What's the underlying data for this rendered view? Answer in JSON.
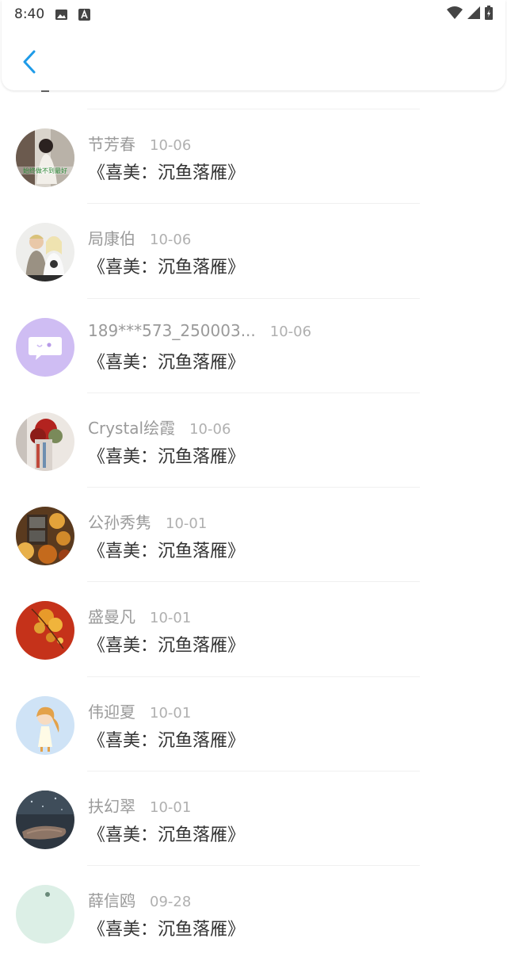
{
  "status_bar": {
    "time": "8:40"
  },
  "header": {
    "back_icon": "chevron-left-icon",
    "accent": "#1e9be8"
  },
  "items": [
    {
      "name": "节芳春",
      "date": "10-06",
      "content": "《喜美：沉鱼落雁》",
      "avatar_text": "始终做不到最好"
    },
    {
      "name": "局康伯",
      "date": "10-06",
      "content": "《喜美：沉鱼落雁》"
    },
    {
      "name": "189***573_250003...",
      "date": "10-06",
      "content": "《喜美：沉鱼落雁》"
    },
    {
      "name": "Crystal绘霞",
      "date": "10-06",
      "content": "《喜美：沉鱼落雁》"
    },
    {
      "name": "公孙秀隽",
      "date": "10-01",
      "content": "《喜美：沉鱼落雁》"
    },
    {
      "name": "盛曼凡",
      "date": "10-01",
      "content": "《喜美：沉鱼落雁》"
    },
    {
      "name": "伟迎夏",
      "date": "10-01",
      "content": "《喜美：沉鱼落雁》"
    },
    {
      "name": "扶幻翠",
      "date": "10-01",
      "content": "《喜美：沉鱼落雁》"
    },
    {
      "name": "薛信鸥",
      "date": "09-28",
      "content": "《喜美：沉鱼落雁》"
    }
  ]
}
